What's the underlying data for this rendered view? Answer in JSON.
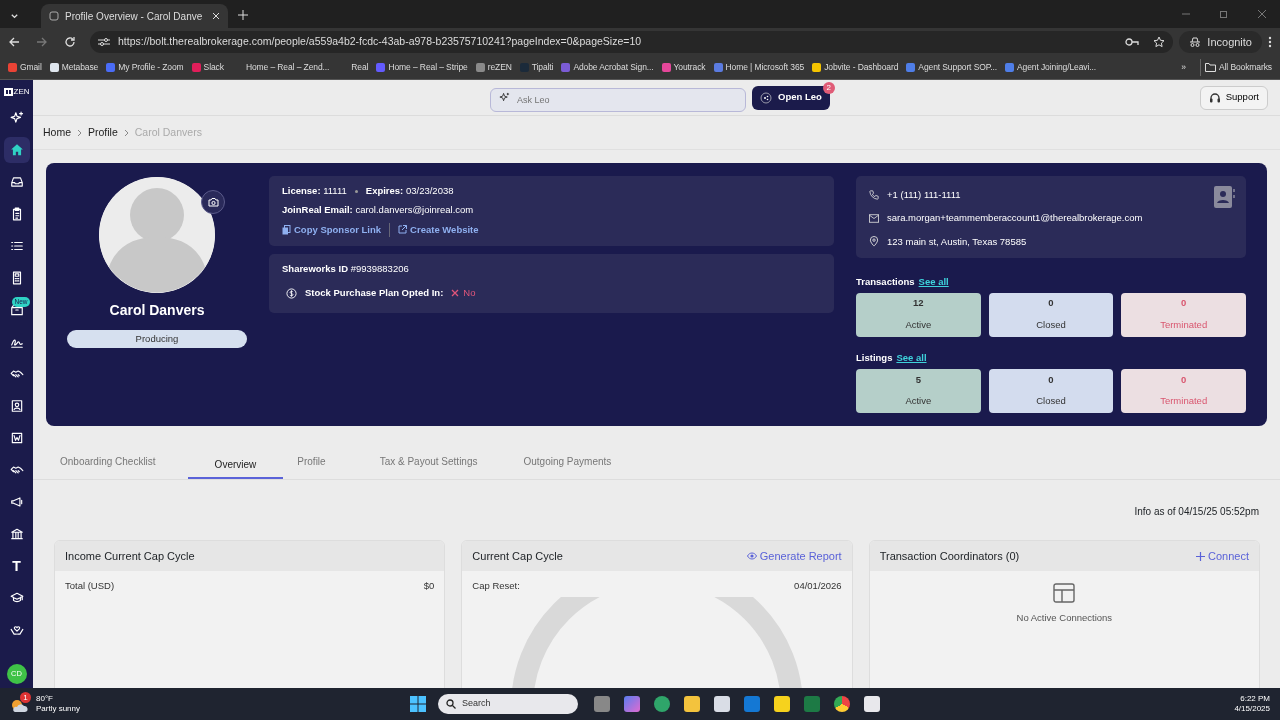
{
  "browser": {
    "tab": {
      "title": "Profile Overview - Carol Danve"
    },
    "url": "https://bolt.therealbrokerage.com/people/a559a4b2-fcdc-43ab-a978-b23575710241?pageIndex=0&pageSize=10",
    "forward_disabled": true,
    "profile_chip": "Incognito",
    "bookmarks": [
      {
        "label": "Gmail",
        "color": "#ea4335"
      },
      {
        "label": "Metabase",
        "color": "#dfe6ee"
      },
      {
        "label": "My Profile - Zoom",
        "color": "#4a6cf7"
      },
      {
        "label": "Slack",
        "color": "#e01e5a"
      },
      {
        "label": "Home – Real – Zend..."
      },
      {
        "label": "Real"
      },
      {
        "label": "Home – Real – Stripe",
        "color": "#635bff"
      },
      {
        "label": "reZEN",
        "color": "#8a8a8a"
      },
      {
        "label": "Tipalti",
        "color": "#1b2a3a"
      },
      {
        "label": "Adobe Acrobat Sign...",
        "color": "#7b5cd6"
      },
      {
        "label": "Youtrack",
        "color": "#e5479a"
      },
      {
        "label": "Home | Microsoft 365",
        "color": "#5b7be0"
      },
      {
        "label": "Jobvite - Dashboard",
        "color": "#f5c400"
      },
      {
        "label": "Agent Support SOP...",
        "color": "#4f7ee8"
      },
      {
        "label": "Agent Joining/Leavi...",
        "color": "#4f7ee8"
      }
    ],
    "more": "»",
    "all_bookmarks": "All Bookmarks"
  },
  "sidebar": {
    "logo": "ZEN",
    "items": [
      {
        "kind": "sparkle",
        "selected": false
      },
      {
        "kind": "home",
        "selected": true
      },
      {
        "kind": "inbox",
        "selected": false
      },
      {
        "kind": "clipboard",
        "selected": false
      },
      {
        "kind": "list",
        "selected": false
      },
      {
        "kind": "calculator",
        "selected": false
      },
      {
        "kind": "box",
        "selected": false,
        "badge": "New"
      },
      {
        "kind": "signature",
        "selected": false
      },
      {
        "kind": "handshake",
        "selected": false
      },
      {
        "kind": "idcard",
        "selected": false
      },
      {
        "kind": "document",
        "selected": false
      },
      {
        "kind": "handshake",
        "selected": false
      },
      {
        "kind": "megaphone",
        "selected": false
      },
      {
        "kind": "bank",
        "selected": false
      },
      {
        "kind": "glyph",
        "glyph": "T",
        "selected": false
      },
      {
        "kind": "cap",
        "selected": false
      },
      {
        "kind": "hands",
        "selected": false
      }
    ],
    "avatar": "CD"
  },
  "header": {
    "ask_placeholder": "Ask Leo",
    "open_button": "Open Leo",
    "open_badge": "2",
    "support": "Support"
  },
  "breadcrumbs": [
    {
      "label": "Home",
      "current": false
    },
    {
      "label": "Profile",
      "current": false
    },
    {
      "label": "Carol Danvers",
      "current": true
    }
  ],
  "profile": {
    "name": "Carol Danvers",
    "status": "Producing",
    "license": {
      "label": "License:",
      "value": "11111"
    },
    "expires": {
      "label": "Expires:",
      "value": "03/23/2038"
    },
    "email": {
      "label": "JoinReal Email:",
      "value": "carol.danvers@joinreal.com"
    },
    "links": [
      "Copy Sponsor Link",
      "Create Website"
    ],
    "shareworks": {
      "label": "Shareworks ID",
      "value": "#9939883206"
    },
    "stock_plan": {
      "label": "Stock Purchase Plan Opted In:",
      "opted": false,
      "value": "No"
    },
    "contact": {
      "phone": "+1 (111) 111-1111",
      "email": "sara.morgan+teammemberaccount1@therealbrokerage.com",
      "address": "123 main st, Austin, Texas 78585"
    },
    "groups": [
      {
        "title": "Transactions",
        "link": "See all",
        "stats": [
          {
            "kind": "active",
            "count": "12",
            "label": "Active"
          },
          {
            "kind": "closed",
            "count": "0",
            "label": "Closed"
          },
          {
            "kind": "terminated",
            "count": "0",
            "label": "Terminated"
          }
        ]
      },
      {
        "title": "Listings",
        "link": "See all",
        "stats": [
          {
            "kind": "active",
            "count": "5",
            "label": "Active"
          },
          {
            "kind": "closed",
            "count": "0",
            "label": "Closed"
          },
          {
            "kind": "terminated",
            "count": "0",
            "label": "Terminated"
          }
        ]
      }
    ]
  },
  "tabs": [
    {
      "label": "Onboarding Checklist",
      "selected": false
    },
    {
      "label": "Overview",
      "selected": true
    },
    {
      "label": "Profile",
      "selected": false
    },
    {
      "label": "Tax & Payout Settings",
      "selected": false
    },
    {
      "label": "Outgoing Payments",
      "selected": false
    }
  ],
  "info": "Info as of 04/15/25 05:52pm",
  "cards": [
    {
      "kind": "rows",
      "title": "Income Current Cap Cycle",
      "rows": [
        {
          "label": "Total (USD)",
          "value": "$0"
        }
      ]
    },
    {
      "kind": "gauge",
      "title": "Current Cap Cycle",
      "action": {
        "label": "Generate Report"
      },
      "rows": [
        {
          "label": "Cap Reset:",
          "value": "04/01/2026"
        }
      ]
    },
    {
      "kind": "empty",
      "title": "Transaction Coordinators (0)",
      "action": {
        "label": "Connect"
      },
      "empty": "No Active Connections"
    }
  ],
  "taskbar": {
    "weather": {
      "badge": "1",
      "temp": "80°F",
      "desc": "Partly sunny"
    },
    "search_placeholder": "Search",
    "time": "6:22 PM",
    "date": "4/15/2025"
  }
}
